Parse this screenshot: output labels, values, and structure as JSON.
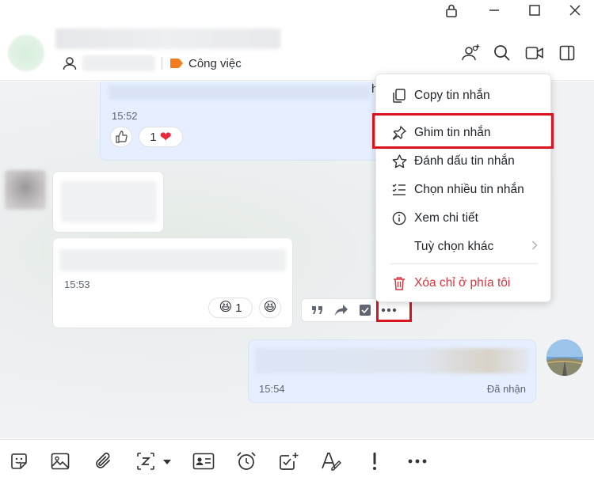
{
  "header": {
    "tag_label": "Công việc",
    "tag_color": "#f07d1e"
  },
  "icons": {
    "lock": "lock-icon",
    "minimize": "minimize-icon",
    "maximize": "maximize-icon",
    "close": "close-icon",
    "add_member": "add-member-icon",
    "search": "search-icon",
    "video": "video-call-icon",
    "sidebar": "sidebar-toggle-icon"
  },
  "messages": [
    {
      "time": "15:52",
      "reactions": [
        {
          "emoji": "👍",
          "count": ""
        },
        {
          "emoji": "❤",
          "count": "1"
        }
      ]
    },
    {
      "time": "15:53",
      "reactions": [
        {
          "emoji": "😆",
          "count": "1"
        },
        {
          "emoji": "😆",
          "count": ""
        }
      ]
    },
    {
      "time": "15:54",
      "status": "Đã nhận"
    }
  ],
  "partial_text": "h",
  "context_menu": {
    "items": [
      {
        "label": "Copy tin nhắn"
      },
      {
        "label": "Ghim tin nhắn"
      },
      {
        "label": "Đánh dấu tin nhắn"
      },
      {
        "label": "Chọn nhiều tin nhắn"
      },
      {
        "label": "Xem chi tiết"
      },
      {
        "label": "Tuỳ chọn khác"
      },
      {
        "label": "Xóa chỉ ở phía tôi"
      }
    ],
    "danger_color": "#d9363e"
  },
  "highlight_color": "#d9141c",
  "accent_color": "#e5efff"
}
